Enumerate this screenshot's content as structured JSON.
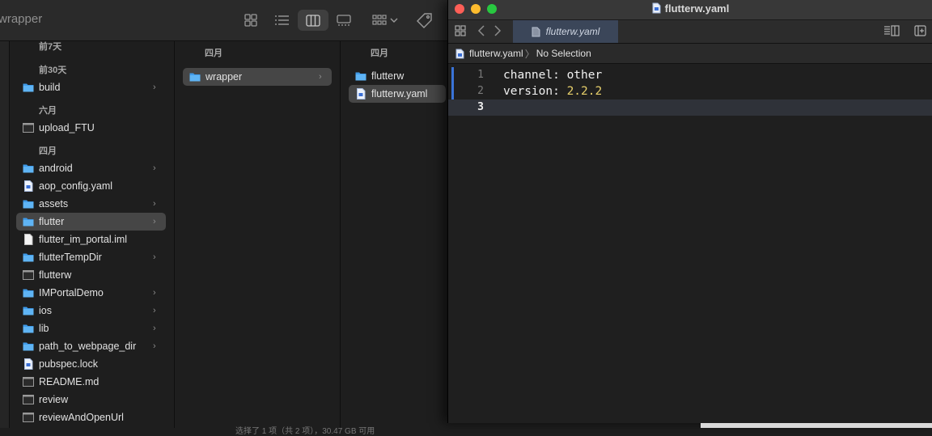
{
  "finder": {
    "window_title": "wrapper",
    "col1": {
      "section_7days": "前7天",
      "section_30days": "前30天",
      "section_june": "六月",
      "section_april": "四月",
      "items_30days": [
        {
          "label": "build",
          "kind": "folder",
          "chev": "›"
        }
      ],
      "items_june": [
        {
          "label": "upload_FTU",
          "kind": "exec"
        }
      ],
      "items_april": [
        {
          "label": "android",
          "kind": "folder",
          "chev": "›"
        },
        {
          "label": "aop_config.yaml",
          "kind": "doc"
        },
        {
          "label": "assets",
          "kind": "folder",
          "chev": "›"
        },
        {
          "label": "flutter",
          "kind": "folder",
          "chev": "›"
        },
        {
          "label": "flutter_im_portal.iml",
          "kind": "file"
        },
        {
          "label": "flutterTempDir",
          "kind": "folder",
          "chev": "›"
        },
        {
          "label": "flutterw",
          "kind": "exec"
        },
        {
          "label": "IMPortalDemo",
          "kind": "folder",
          "chev": "›"
        },
        {
          "label": "ios",
          "kind": "folder",
          "chev": "›"
        },
        {
          "label": "lib",
          "kind": "folder",
          "chev": "›"
        },
        {
          "label": "path_to_webpage_dir",
          "kind": "folder",
          "chev": "›"
        },
        {
          "label": "pubspec.lock",
          "kind": "doc"
        },
        {
          "label": "README.md",
          "kind": "exec"
        },
        {
          "label": "review",
          "kind": "exec"
        },
        {
          "label": "reviewAndOpenUrl",
          "kind": "exec"
        }
      ]
    },
    "col2": {
      "header": "四月",
      "items": [
        {
          "label": "wrapper",
          "chev": "›"
        }
      ]
    },
    "col3": {
      "header": "四月",
      "items": [
        {
          "label": "flutterw",
          "kind": "folder"
        },
        {
          "label": "flutterw.yaml",
          "kind": "doc"
        }
      ]
    },
    "status_text": "选择了 1 项（共 2 项），30.47 GB 可用"
  },
  "editor": {
    "title": "flutterw.yaml",
    "tab_label": "flutterw.yaml",
    "jump_file": "flutterw.yaml",
    "jump_sep": "〉",
    "jump_selection": "No Selection",
    "lines": [
      {
        "num": "1",
        "key": "channel: ",
        "value": "other",
        "value_kind": "word"
      },
      {
        "num": "2",
        "key": "version: ",
        "value": "2.2.2",
        "value_kind": "number"
      },
      {
        "num": "3",
        "key": "",
        "value": "",
        "value_kind": "word"
      }
    ]
  },
  "colors": {
    "folder_blue": "#5fb4f4",
    "tab_active": "#3b4659",
    "gutter_marker": "#3a74d8",
    "number_literal": "#e6cf6a",
    "traffic_close": "#fe5f57",
    "traffic_min": "#febc2e",
    "traffic_max": "#28c840"
  },
  "icons": [
    "grid-view-icon",
    "list-view-icon",
    "column-view-icon",
    "gallery-view-icon",
    "group-icon",
    "tag-icon",
    "folder-icon",
    "document-icon",
    "executable-icon",
    "chevron-right-icon",
    "back-icon",
    "forward-icon",
    "inspector-icon",
    "add-editor-icon"
  ]
}
